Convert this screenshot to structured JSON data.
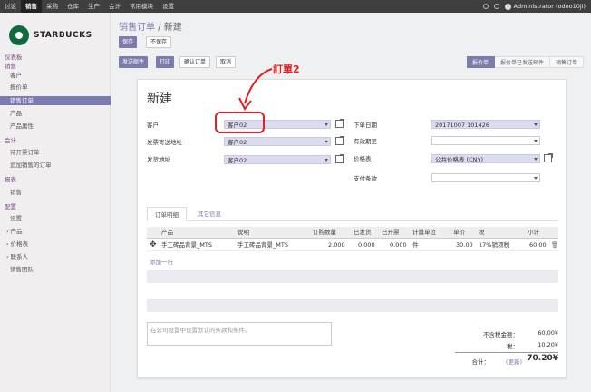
{
  "topnav": {
    "items": [
      "讨论",
      "销售",
      "采购",
      "仓库",
      "生产",
      "会计",
      "常用模块",
      "设置"
    ],
    "active_index": 1,
    "user": "Administrator (odoo10ji)"
  },
  "brand": {
    "name": "STARBUCKS"
  },
  "sidebar": {
    "items": [
      {
        "label": "仪表板",
        "kind": "section"
      },
      {
        "label": "销售",
        "kind": "section"
      },
      {
        "label": "客户",
        "kind": "link"
      },
      {
        "label": "报价单",
        "kind": "link"
      },
      {
        "label": "销售订单",
        "kind": "link",
        "active": true
      },
      {
        "label": "产品",
        "kind": "link"
      },
      {
        "label": "产品属性",
        "kind": "link"
      },
      {
        "label": "会计",
        "kind": "section"
      },
      {
        "label": "待开票订单",
        "kind": "link"
      },
      {
        "label": "追加销售的订单",
        "kind": "link"
      },
      {
        "label": "报表",
        "kind": "section"
      },
      {
        "label": "销售",
        "kind": "link"
      },
      {
        "label": "配置",
        "kind": "section"
      },
      {
        "label": "设置",
        "kind": "link"
      },
      {
        "label": "› 产品",
        "kind": "sub"
      },
      {
        "label": "› 价格表",
        "kind": "sub"
      },
      {
        "label": "› 联系人",
        "kind": "sub"
      },
      {
        "label": "销售团队",
        "kind": "link"
      }
    ]
  },
  "breadcrumb": {
    "parent": "销售订单",
    "separator": " / ",
    "current": "新建"
  },
  "toolbar": {
    "save": "保存",
    "discard": "不保存"
  },
  "actions": {
    "send_email": "发送邮件",
    "print": "打印",
    "confirm": "确认订单",
    "cancel": "取消"
  },
  "statusbar": {
    "steps": [
      "报价单",
      "报价单已发送邮件",
      "销售订单"
    ],
    "active_index": 0
  },
  "form": {
    "title": "新建",
    "customer_label": "客户",
    "customer_value": "客户02",
    "invoice_addr_label": "发票寄送地址",
    "invoice_addr_value": "客户02",
    "ship_addr_label": "发货地址",
    "ship_addr_value": "客户02",
    "order_date_label": "下单日期",
    "order_date_value": "20171007 101426",
    "validity_label": "有效期至",
    "validity_value": "",
    "pricelist_label": "价格表",
    "pricelist_value": "公共价格表 (CNY)",
    "payment_label": "支付条款",
    "payment_value": ""
  },
  "tabs": {
    "lines": "订单明细",
    "other": "其它信息"
  },
  "table": {
    "headers": [
      "产品",
      "说明",
      "订购数量",
      "已发货",
      "已开票",
      "计量单位",
      "单价",
      "税",
      "小计"
    ],
    "rows": [
      {
        "product": "手工砖品背景_MTS",
        "desc": "手工砖品背景_MTS",
        "qty": "2.000",
        "delivered": "0.000",
        "invoiced": "0.000",
        "uom": "件",
        "price": "30.00",
        "tax": "17%销项税",
        "subtotal": "60.00"
      }
    ],
    "add_line": "添加一行"
  },
  "notes_placeholder": "在公司设置中设置默认的条款和条件。",
  "totals": {
    "untaxed_label": "不含税金额：",
    "untaxed_value": "60.00¥",
    "tax_label": "税：",
    "tax_value": "10.20¥",
    "total_label": "合计：",
    "update_label": "(更新)",
    "total_value": "70.20¥"
  },
  "annotation": {
    "text": "訂單2",
    "color": "#e02020"
  }
}
